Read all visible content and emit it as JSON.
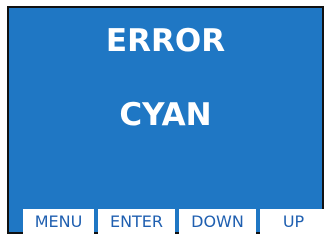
{
  "display": {
    "title": "ERROR",
    "value": "CYAN",
    "background_color": "#1f77c4"
  },
  "softkeys": [
    {
      "label": "MENU"
    },
    {
      "label": "ENTER"
    },
    {
      "label": "DOWN"
    },
    {
      "label": "UP"
    }
  ]
}
